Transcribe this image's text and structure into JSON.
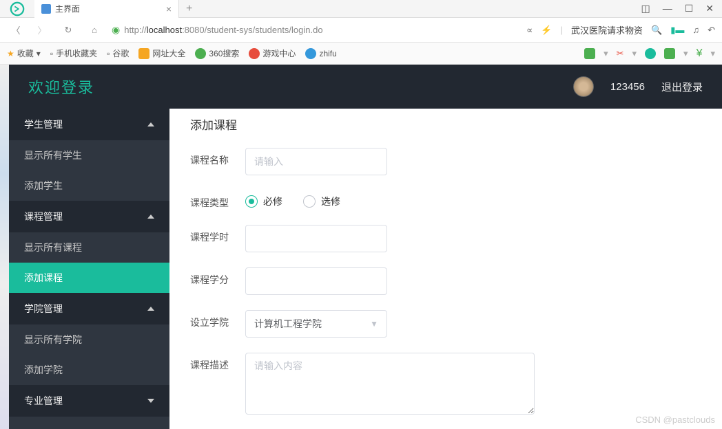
{
  "browser": {
    "tab_title": "主界面",
    "url_prefix": "http://",
    "url_host": "localhost",
    "url_path": ":8080/student-sys/students/login.do",
    "hot_text": "武汉医院请求物资"
  },
  "bookmarks": {
    "fav": "收藏",
    "items": [
      "手机收藏夹",
      "谷歌",
      "网址大全",
      "360搜索",
      "游戏中心",
      "zhifu"
    ]
  },
  "header": {
    "title": "欢迎登录",
    "user_id": "123456",
    "logout": "退出登录"
  },
  "sidebar": {
    "groups": [
      {
        "label": "学生管理",
        "open": true,
        "items": [
          "显示所有学生",
          "添加学生"
        ]
      },
      {
        "label": "课程管理",
        "open": true,
        "items": [
          "显示所有课程",
          "添加课程"
        ],
        "active": "添加课程"
      },
      {
        "label": "学院管理",
        "open": true,
        "items": [
          "显示所有学院",
          "添加学院"
        ]
      },
      {
        "label": "专业管理",
        "open": false,
        "items": []
      }
    ]
  },
  "form": {
    "title": "添加课程",
    "name_label": "课程名称",
    "name_placeholder": "请输入",
    "type_label": "课程类型",
    "type_required": "必修",
    "type_optional": "选修",
    "hours_label": "课程学时",
    "credit_label": "课程学分",
    "college_label": "设立学院",
    "college_value": "计算机工程学院",
    "desc_label": "课程描述",
    "desc_placeholder": "请输入内容"
  },
  "watermark": "CSDN @pastclouds"
}
